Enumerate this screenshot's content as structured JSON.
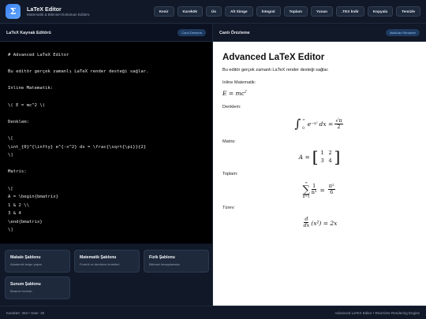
{
  "app": {
    "logo_glyph": "Σ",
    "title": "LaTeX Editor",
    "subtitle": "Matematik & Bilimsel Doküman Editörü"
  },
  "toolbar": {
    "buttons": [
      "Kesir",
      "Karekök",
      "Üs",
      "Alt Simge",
      "İntegral",
      "Toplam",
      "Yunan",
      ".TEX İndir",
      "Kopyala",
      "Temizle"
    ]
  },
  "editor": {
    "title": "LaTeX Kaynak Editörü",
    "badge": "Canlı Derleme",
    "lines": [
      "# Advanced LaTeX Editor",
      "",
      "Bu editör gerçek zamanlı LaTeX render desteği sağlar.",
      "",
      "Inline Matematik:",
      "",
      "\\( E = mc^2 \\)",
      "",
      "Denklem:",
      "",
      "\\[",
      "\\int_{0}^{\\infty} e^{-x^2} dx = \\frac{\\sqrt{\\pi}}{2}",
      "\\]",
      "",
      "Matris:",
      "",
      "\\[",
      "A = \\begin{bmatrix}",
      "1 & 2 \\\\",
      "3 & 4",
      "\\end{bmatrix}",
      "\\]"
    ]
  },
  "templates": [
    {
      "name": "Makale Şablonu",
      "desc": "Akademik belge yapısı"
    },
    {
      "name": "Matematik Şablonu",
      "desc": "Formül ve denklem örnekleri"
    },
    {
      "name": "Fizik Şablonu",
      "desc": "Bilimsel hesaplamalar"
    },
    {
      "name": "Sunum Şablonu",
      "desc": "Beamer formatı"
    }
  ],
  "preview": {
    "title": "Canlı Önizleme",
    "badge": "MathJax Renderer",
    "heading": "Advanced LaTeX Editor",
    "intro": "Bu editör gerçek zamanlı LaTeX render desteği sağlar.",
    "inline_label": "Inline Matematik:",
    "equation_label": "Denklem:",
    "matrix_label": "Matris:",
    "sum_label": "Toplam:",
    "derivative_label": "Türev:",
    "math": {
      "inline_lhs": "E = mc",
      "inline_exp": "2",
      "int_lower": "0",
      "int_upper": "∞",
      "int_body": "e",
      "int_exp": "−x²",
      "int_dx": "dx =",
      "int_num": "√π",
      "int_den": "2",
      "matrix_name": "A =",
      "matrix": [
        "1",
        "2",
        "3",
        "4"
      ],
      "sum_upper": "∞",
      "sum_lower": "n=1",
      "sum_num": "1",
      "sum_den": "n²",
      "sum_eq": "=",
      "sum_rnum": "π²",
      "sum_rden": "6",
      "der_num": "d",
      "der_den": "dx",
      "der_body": "(x²) = 2x"
    }
  },
  "footer": {
    "stats": "Karakter: 353 • Satır: 35",
    "engine": "Advanced LaTeX Editor • Real-time Rendering Engine"
  },
  "colors": {
    "accent": "#3b82f6",
    "background": "#0f172a",
    "editor_bg": "#000000"
  }
}
